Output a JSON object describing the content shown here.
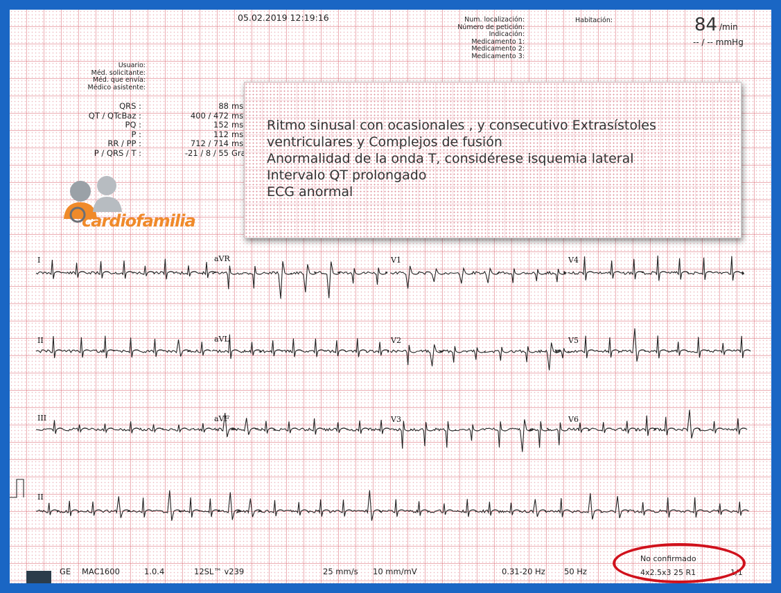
{
  "header": {
    "datetime": "05.02.2019  12:19:16",
    "location_labels": [
      "Num. localización:",
      "Número de petición:",
      "Indicación:",
      "Medicamento 1:",
      "Medicamento 2:",
      "Medicamento 3:"
    ],
    "habitacion": "Habitación:",
    "heart_rate": "84",
    "heart_rate_unit": "/min",
    "blood_pressure": "-- / -- mmHg"
  },
  "user_block": [
    "Usuario:",
    "Méd. solicitante:",
    "Méd. que envía:",
    "Médico asistente:"
  ],
  "measurements": [
    {
      "label": "QRS :",
      "value": "88",
      "unit": "ms"
    },
    {
      "label": "QT / QTcBaz :",
      "value": "400 / 472",
      "unit": "ms"
    },
    {
      "label": "PQ :",
      "value": "152",
      "unit": "ms"
    },
    {
      "label": "P :",
      "value": "112",
      "unit": "ms"
    },
    {
      "label": "RR / PP :",
      "value": "712 / 714",
      "unit": "ms"
    },
    {
      "label": "P / QRS / T :",
      "value": "-21 / 8 / 55",
      "unit": "Grados"
    }
  ],
  "logo": {
    "text": "cardiofamilia",
    "accent_color": "#f08a2a"
  },
  "interpretation": [
    "Ritmo sinusal con ocasionales , y consecutivo Extrasístoles",
    "ventriculares y Complejos de fusión",
    "Anormalidad de la onda T, considérese isquemia lateral",
    "Intervalo QT prolongado",
    "ECG anormal"
  ],
  "leads": {
    "row1": [
      "I",
      "aVR",
      "V1",
      "V4"
    ],
    "row2": [
      "II",
      "aVL",
      "V2",
      "V5"
    ],
    "row3": [
      "III",
      "aVF",
      "V3",
      "V6"
    ],
    "rhythm": "II"
  },
  "footer": {
    "device": "GE",
    "model": "MAC1600",
    "version": "1.0.4",
    "software": "12SL™ v239",
    "speed": "25 mm/s",
    "gain": "10 mm/mV",
    "filter": "0.31-20 Hz",
    "mains": "50 Hz",
    "status": "No confirmado",
    "format": "4x2.5x3  25  R1",
    "page": "1/1"
  },
  "colors": {
    "frame": "#1a66c4",
    "grid": "#dc6e78",
    "highlight_oval": "#d0111c"
  }
}
